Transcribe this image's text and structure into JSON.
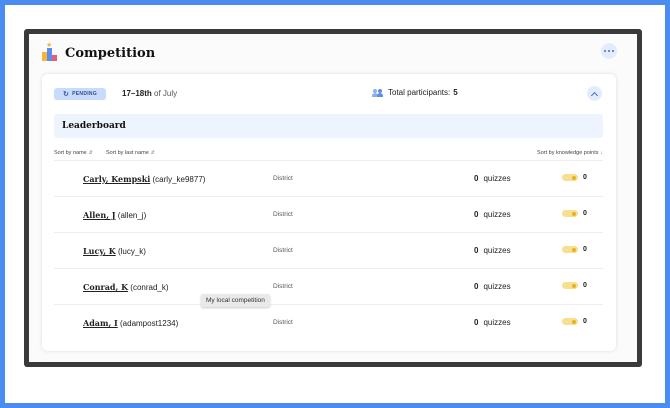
{
  "page": {
    "title": "Competition",
    "icons": {
      "title": "leaderboard-trophy-icon",
      "more": "more-options-icon"
    }
  },
  "card": {
    "status": "PENDING",
    "status_icon": "refresh-icon",
    "date_range": "17–18th",
    "date_of": "of July",
    "participants_label": "Total participants:",
    "participants_count": "5",
    "participants_icon": "people-icon",
    "collapse_icon": "chevron-up-icon"
  },
  "leaderboard": {
    "title": "Leaderboard",
    "sort_name": "Sort by name",
    "sort_last_name": "Sort by last name",
    "sort_points": "Sort by knowledge points",
    "rows": [
      {
        "display": "Carly, Kempski",
        "username": "(carly_ke9877)",
        "district": "District",
        "quizzes": "0",
        "quizzes_label": "quizzes",
        "points": "0"
      },
      {
        "display": "Allen, J",
        "username": "(allen_j)",
        "district": "District",
        "quizzes": "0",
        "quizzes_label": "quizzes",
        "points": "0"
      },
      {
        "display": "Lucy, K",
        "username": "(lucy_k)",
        "district": "District",
        "quizzes": "0",
        "quizzes_label": "quizzes",
        "points": "0"
      },
      {
        "display": "Conrad, K",
        "username": "(conrad_k)",
        "district": "District",
        "quizzes": "0",
        "quizzes_label": "quizzes",
        "points": "0"
      },
      {
        "display": "Adam, I",
        "username": "(adampost1234)",
        "district": "District",
        "quizzes": "0",
        "quizzes_label": "quizzes",
        "points": "0"
      }
    ]
  },
  "tooltip": {
    "text": "My local competition"
  },
  "colors": {
    "frame": "#4a8cf0",
    "accent": "#3b6fd8",
    "pending_bg": "#c9dbfa",
    "points_pill": "#f6df8e"
  }
}
